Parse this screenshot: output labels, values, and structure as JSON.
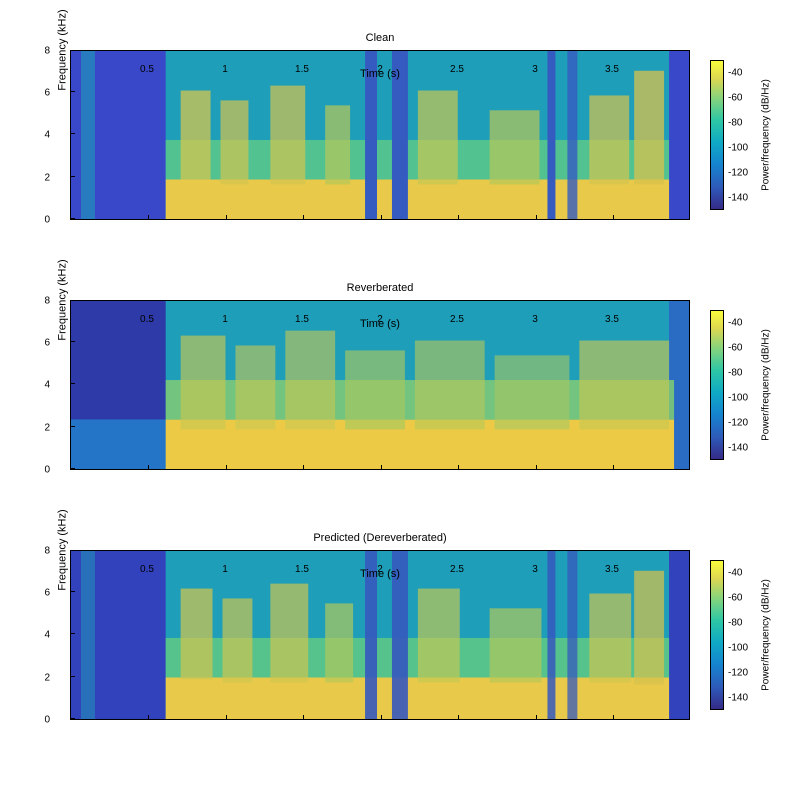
{
  "chart_data": [
    {
      "type": "heatmap",
      "title": "Clean",
      "xlabel": "Time (s)",
      "ylabel": "Frequency (kHz)",
      "xlim": [
        0,
        4.0
      ],
      "ylim": [
        0,
        8
      ],
      "xticks": [
        0.5,
        1,
        1.5,
        2,
        2.5,
        3,
        3.5
      ],
      "yticks": [
        0,
        2,
        4,
        6,
        8
      ],
      "colorbar": {
        "label": "Power/frequency (dB/Hz)",
        "range": [
          -150,
          -30
        ],
        "ticks": [
          -140,
          -120,
          -100,
          -80,
          -60,
          -40
        ]
      },
      "description": "Spectrogram of clean (non-reverberated) speech signal. Low energy (blue, ~-140 dB) below ~0.6s and above ~3.8s indicating silence. Speech activity ~0.6-3.8s with high energy (yellow/orange, -40 to -60 dB) concentrated 0-2 kHz, harmonic structure visible, vertical striations at ~1.9, 2.1, 3.0s indicating plosives/silences. Upper frequencies 4-8 kHz mostly cyan (~-90 to -110 dB)."
    },
    {
      "type": "heatmap",
      "title": "Reverberated",
      "xlabel": "Time (s)",
      "ylabel": "Frequency (kHz)",
      "xlim": [
        0,
        4.0
      ],
      "ylim": [
        0,
        8
      ],
      "xticks": [
        0.5,
        1,
        1.5,
        2,
        2.5,
        3,
        3.5
      ],
      "yticks": [
        0,
        2,
        4,
        6,
        8
      ],
      "colorbar": {
        "label": "Power/frequency (dB/Hz)",
        "range": [
          -150,
          -30
        ],
        "ticks": [
          -140,
          -120,
          -100,
          -80,
          -60,
          -40
        ]
      },
      "description": "Spectrogram of reverberated speech. Similar overall structure to Clean but energy smeared temporally — vertical gaps filled in, low-frequency band (0-2 kHz) shows continuous high energy ~0.6-3.9s. Onset region 0-0.6s darker blue. Less sharp time boundaries than Clean."
    },
    {
      "type": "heatmap",
      "title": "Predicted (Dereverberated)",
      "xlabel": "Time (s)",
      "ylabel": "Frequency (kHz)",
      "xlim": [
        0,
        4.0
      ],
      "ylim": [
        0,
        8
      ],
      "xticks": [
        0.5,
        1,
        1.5,
        2,
        2.5,
        3,
        3.5
      ],
      "yticks": [
        0,
        2,
        4,
        6,
        8
      ],
      "colorbar": {
        "label": "Power/frequency (dB/Hz)",
        "range": [
          -150,
          -30
        ],
        "ticks": [
          -140,
          -120,
          -100,
          -80,
          -60,
          -40
        ]
      },
      "description": "Spectrogram of network-predicted dereverberated output. Closely resembles Clean: vertical low-energy striations restored at ~1.9, 2.1, 3.0, 3.8s. Initial 0-0.6s low energy. Slight residual smearing compared to Clean but much sharper than Reverberated."
    }
  ]
}
